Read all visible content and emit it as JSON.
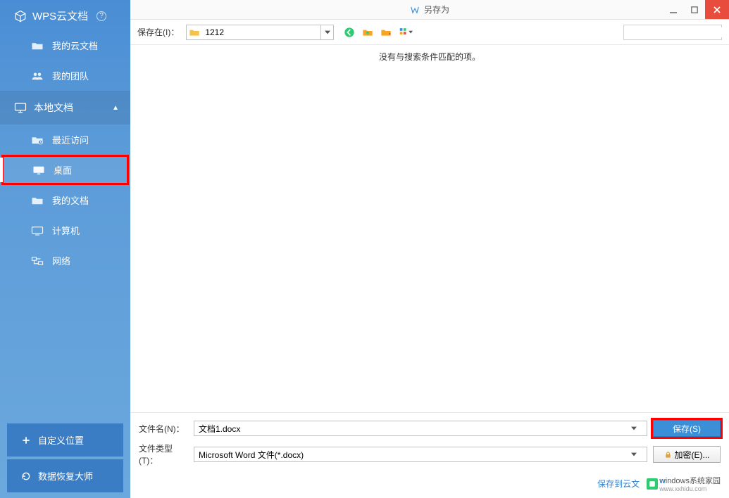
{
  "titlebar": {
    "title": "另存为"
  },
  "sidebar": {
    "brand": "WPS云文档",
    "items_cloud": [
      {
        "label": "我的云文档",
        "name": "my-cloud-docs"
      },
      {
        "label": "我的团队",
        "name": "my-team"
      }
    ],
    "local_section": "本地文档",
    "items_local": [
      {
        "label": "最近访问",
        "name": "recent"
      },
      {
        "label": "桌面",
        "name": "desktop",
        "highlighted": true
      },
      {
        "label": "我的文档",
        "name": "my-documents"
      },
      {
        "label": "计算机",
        "name": "computer"
      },
      {
        "label": "网络",
        "name": "network"
      }
    ],
    "custom_location": "自定义位置",
    "data_recover": "数据恢复大师"
  },
  "toolbar": {
    "save_in_label": "保存在(I)：",
    "folder_name": "1212"
  },
  "content": {
    "empty_msg": "没有与搜索条件匹配的项。"
  },
  "footer": {
    "filename_label": "文件名(N)：",
    "filename_value": "文档1.docx",
    "filetype_label": "文件类型(T)：",
    "filetype_value": "Microsoft Word 文件(*.docx)",
    "save_btn": "保存(S)",
    "encrypt_btn": "加密(E)...",
    "save_cloud_link": "保存到云文",
    "watermark": {
      "w": "w",
      "indows": "indows",
      "suffix": "系统家园",
      "sub": "www.xxhidu.com"
    }
  }
}
